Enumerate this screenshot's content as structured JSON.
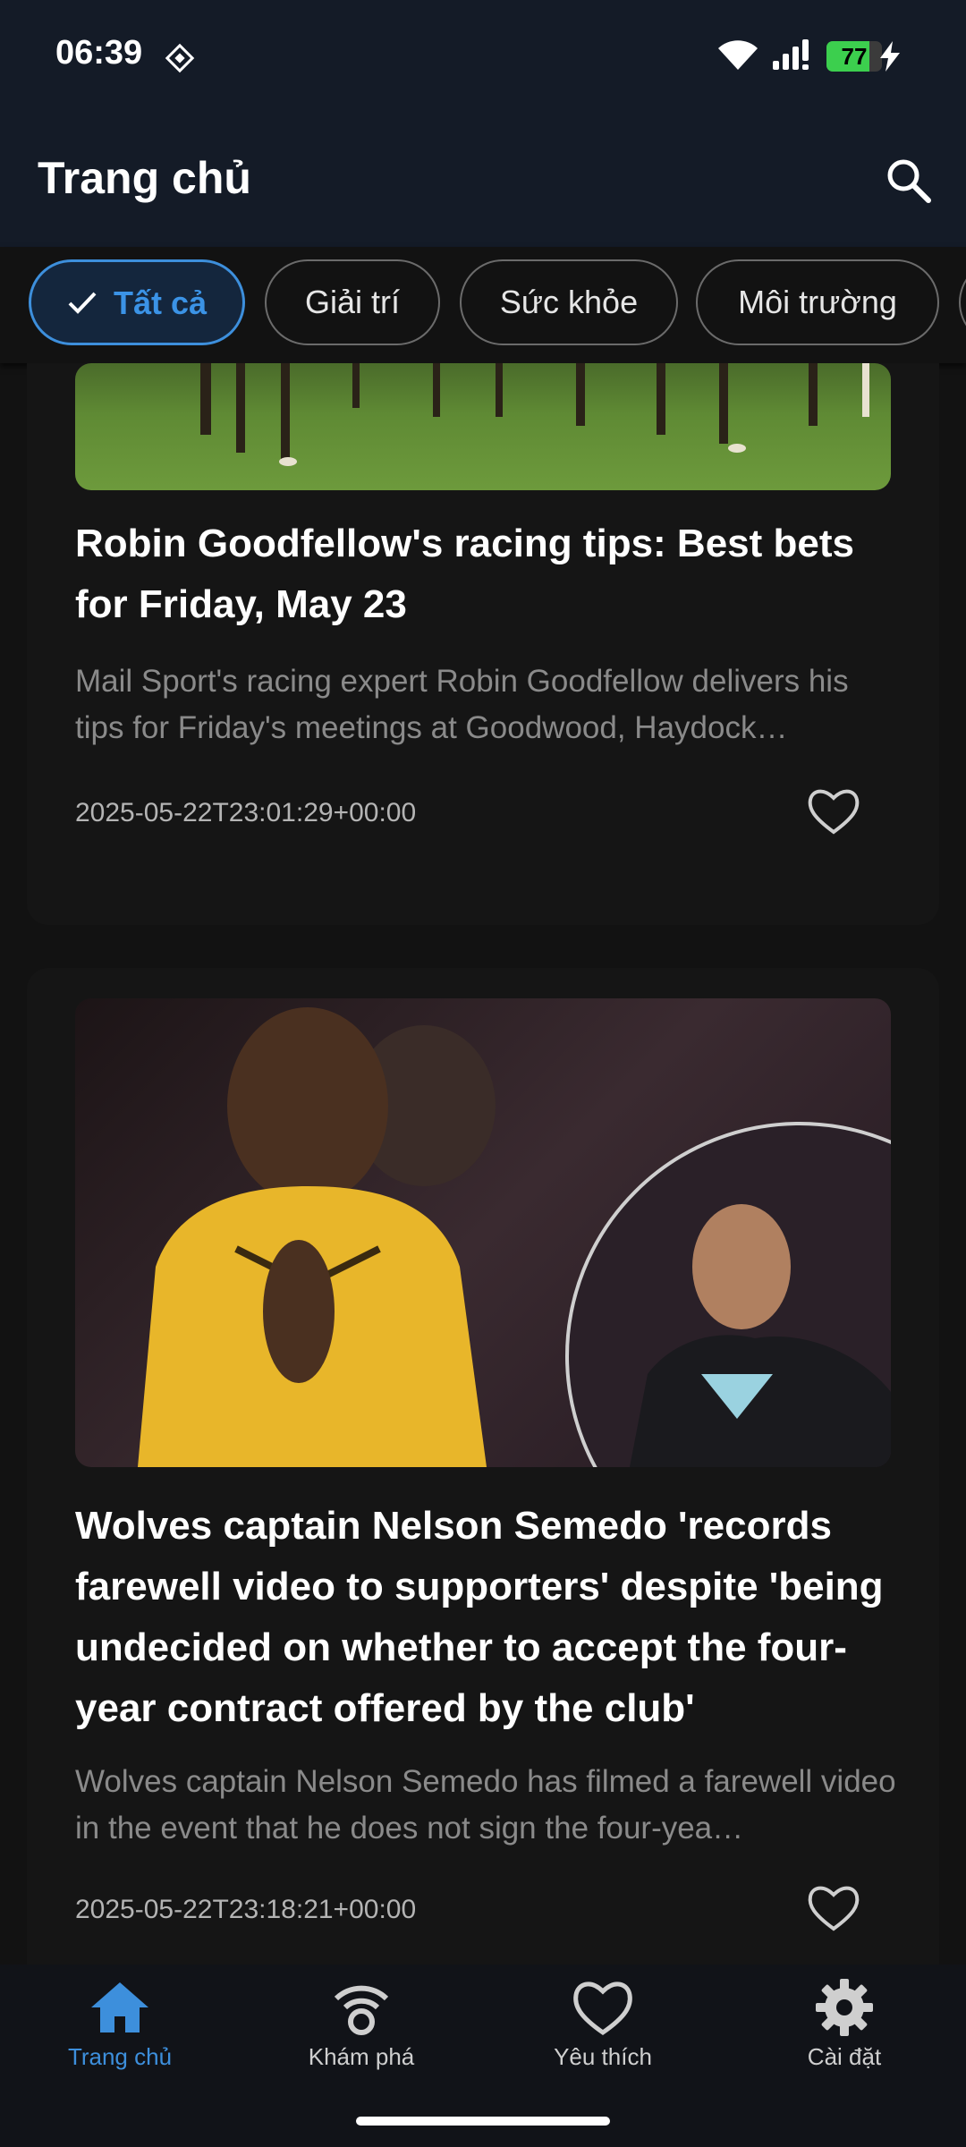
{
  "status": {
    "time": "06:39",
    "battery": "77",
    "battery_level": 0.77
  },
  "app_bar": {
    "title": "Trang chủ"
  },
  "chips": [
    {
      "label": "Tất cả",
      "selected": true
    },
    {
      "label": "Giải trí",
      "selected": false
    },
    {
      "label": "Sức khỏe",
      "selected": false
    },
    {
      "label": "Môi trường",
      "selected": false
    }
  ],
  "articles": [
    {
      "title": "Robin Goodfellow's racing tips: Best bets for Friday, May 23",
      "description": "Mail Sport's racing expert Robin Goodfellow delivers his tips for Friday's meetings at Goodwood, Haydock…",
      "date": "2025-05-22T23:01:29+00:00"
    },
    {
      "title": "Wolves captain Nelson Semedo 'records farewell video to supporters' despite 'being undecided on whether to accept the four-year contract offered by the club'",
      "description": "Wolves captain Nelson Semedo has filmed a farewell video in the event that he does not sign the four-yea…",
      "date": "2025-05-22T23:18:21+00:00"
    }
  ],
  "nav": [
    {
      "label": "Trang chủ",
      "icon": "home-icon",
      "active": true
    },
    {
      "label": "Khám phá",
      "icon": "explore-icon",
      "active": false
    },
    {
      "label": "Yêu thích",
      "icon": "heart-icon",
      "active": false
    },
    {
      "label": "Cài đặt",
      "icon": "gear-icon",
      "active": false
    }
  ],
  "colors": {
    "accent": "#3d8fdc",
    "app_bar": "#141b27",
    "background": "#121212"
  }
}
